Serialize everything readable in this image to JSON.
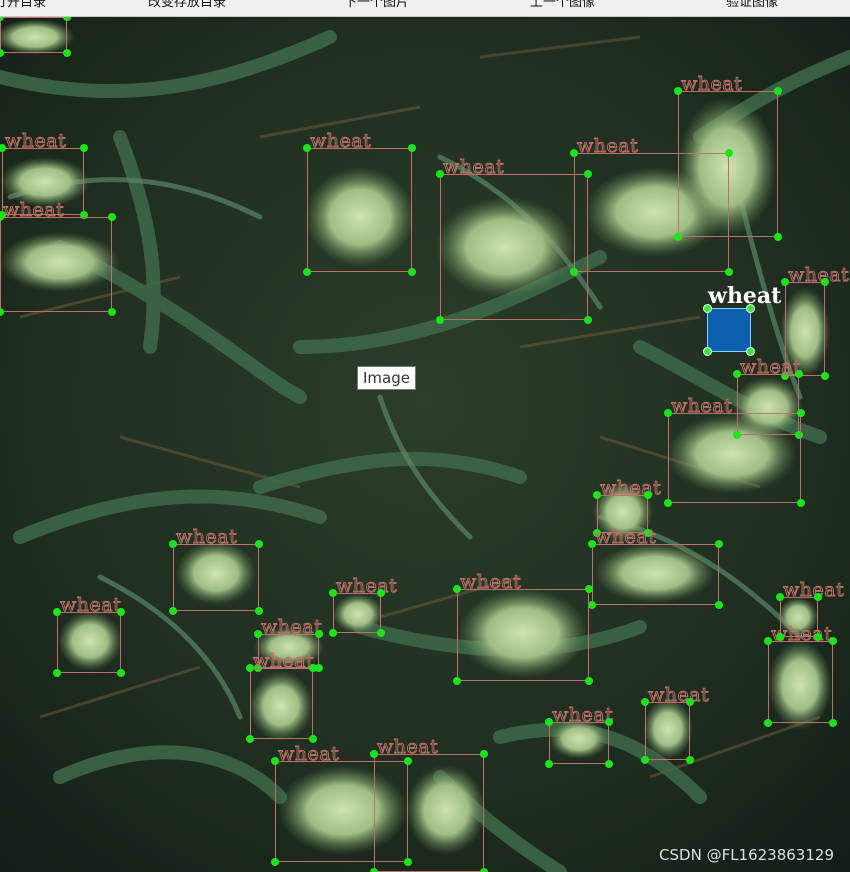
{
  "toolbar": {
    "buttons": [
      "打开目录",
      "改变存放目录",
      "下一个图片",
      "上一个图像",
      "验证图像"
    ]
  },
  "canvas": {
    "label": "wheat",
    "selected_index": 0,
    "label_color": "#c0706a",
    "handle_color": "#19e619",
    "selected_fill": "#0a69c8",
    "box_count": 26
  },
  "tooltip": {
    "text": "Image"
  },
  "watermark": {
    "text": "CSDN @FL1623863129"
  }
}
